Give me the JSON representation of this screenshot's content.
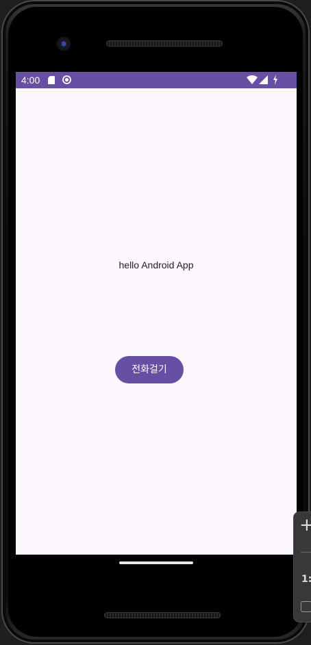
{
  "status_bar": {
    "time": "4:00",
    "background_color": "#6750a4",
    "left_icons": [
      "sd-card-icon",
      "circle-icon"
    ],
    "right_icons": [
      "wifi-icon",
      "cell-signal-icon",
      "battery-charging-icon"
    ]
  },
  "app": {
    "background_color": "#fdf7fe",
    "accent_color": "#6750a4",
    "greeting_text": "hello Android App",
    "call_button_label": "전화걸기"
  },
  "emulator_toolbar": {
    "zoom_in_label": "+",
    "ratio_label": "1:",
    "fit_icon": "fit-screen-icon"
  }
}
